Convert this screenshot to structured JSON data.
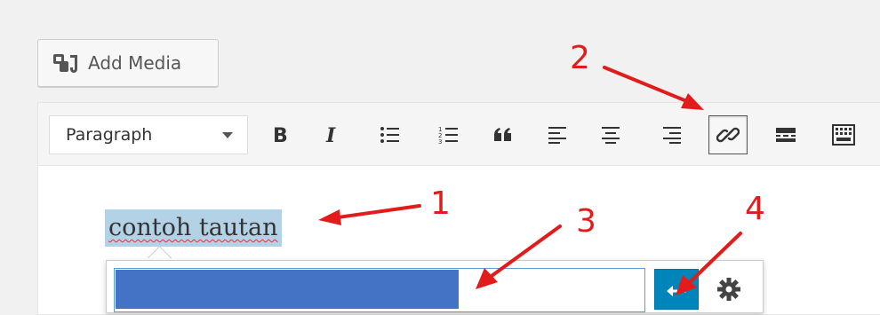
{
  "add_media": {
    "label": "Add Media",
    "icon": "media-icon"
  },
  "toolbar": {
    "format_value": "Paragraph",
    "buttons": [
      {
        "name": "bold",
        "icon": "bold-icon"
      },
      {
        "name": "italic",
        "icon": "italic-icon"
      },
      {
        "name": "bullet-list",
        "icon": "bullet-list-icon"
      },
      {
        "name": "numbered-list",
        "icon": "numbered-list-icon"
      },
      {
        "name": "blockquote",
        "icon": "quote-icon"
      },
      {
        "name": "align-left",
        "icon": "align-left-icon"
      },
      {
        "name": "align-center",
        "icon": "align-center-icon"
      },
      {
        "name": "align-right",
        "icon": "align-right-icon"
      },
      {
        "name": "insert-link",
        "icon": "link-icon",
        "active": true
      },
      {
        "name": "read-more",
        "icon": "read-more-icon"
      },
      {
        "name": "toolbar-toggle",
        "icon": "toolbar-toggle-icon"
      }
    ]
  },
  "content": {
    "selected_text": "contoh tautan"
  },
  "link_popover": {
    "url_value": "",
    "apply_icon": "enter-icon",
    "settings_icon": "gear-icon"
  },
  "annotations": [
    "1",
    "2",
    "3",
    "4"
  ],
  "colors": {
    "annotation": "#e21b1b",
    "selection": "#b4d2e6",
    "url_fill": "#4472c4",
    "apply": "#0085ba"
  }
}
